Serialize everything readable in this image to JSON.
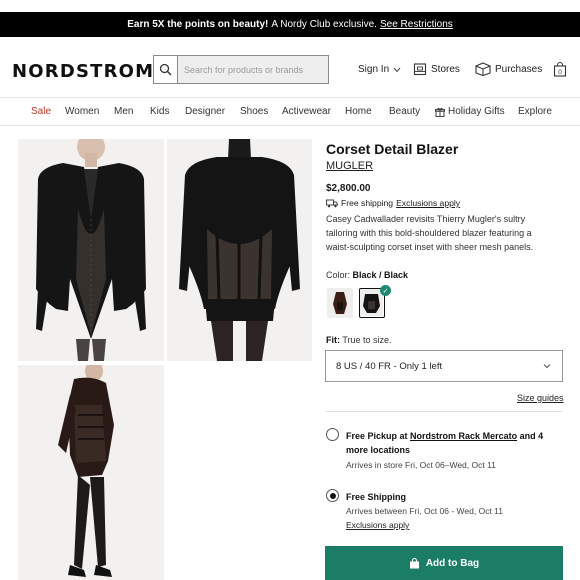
{
  "promo": {
    "bold": "Earn 5X the points on beauty!",
    "text": "A Nordy Club exclusive.",
    "link": "See Restrictions"
  },
  "header": {
    "logo": "NORDSTROM",
    "search_placeholder": "Search for products or brands",
    "sign_in": "Sign In",
    "stores": "Stores",
    "purchases": "Purchases",
    "cart_count": "0"
  },
  "nav": {
    "items": [
      "Sale",
      "Women",
      "Men",
      "Kids",
      "Designer",
      "Shoes",
      "Activewear",
      "Home",
      "Beauty",
      "Holiday Gifts",
      "Explore"
    ]
  },
  "product": {
    "title": "Corset Detail Blazer",
    "brand": "MUGLER",
    "price": "$2,800.00",
    "shipping": "Free shipping",
    "shipping_exclusions": "Exclusions apply",
    "description": "Casey Cadwallader revisits Thierry Mugler's sultry tailoring with this bold-shouldered blazer featuring a waist-sculpting corset inset with sheer mesh panels.",
    "color_label": "Color:",
    "color_value": "Black / Black",
    "fit_label": "Fit:",
    "fit_value": "True to size.",
    "size_selected": "8 US / 40 FR - Only 1 left",
    "size_guides": "Size guides"
  },
  "fulfillment": {
    "pickup_prefix": "Free Pickup at",
    "pickup_location": "Nordstrom Rack Mercato",
    "pickup_suffix": "and 4 more locations",
    "pickup_arrives": "Arrives in store Fri, Oct 06–Wed, Oct 11",
    "shipping_title": "Free Shipping",
    "shipping_arrives": "Arrives between Fri, Oct 06 - Wed, Oct 11",
    "shipping_exclusions": "Exclusions apply"
  },
  "cta": {
    "add_to_bag": "Add to Bag"
  },
  "colors": {
    "accent": "#1b7d66",
    "sale": "#c0392b"
  }
}
